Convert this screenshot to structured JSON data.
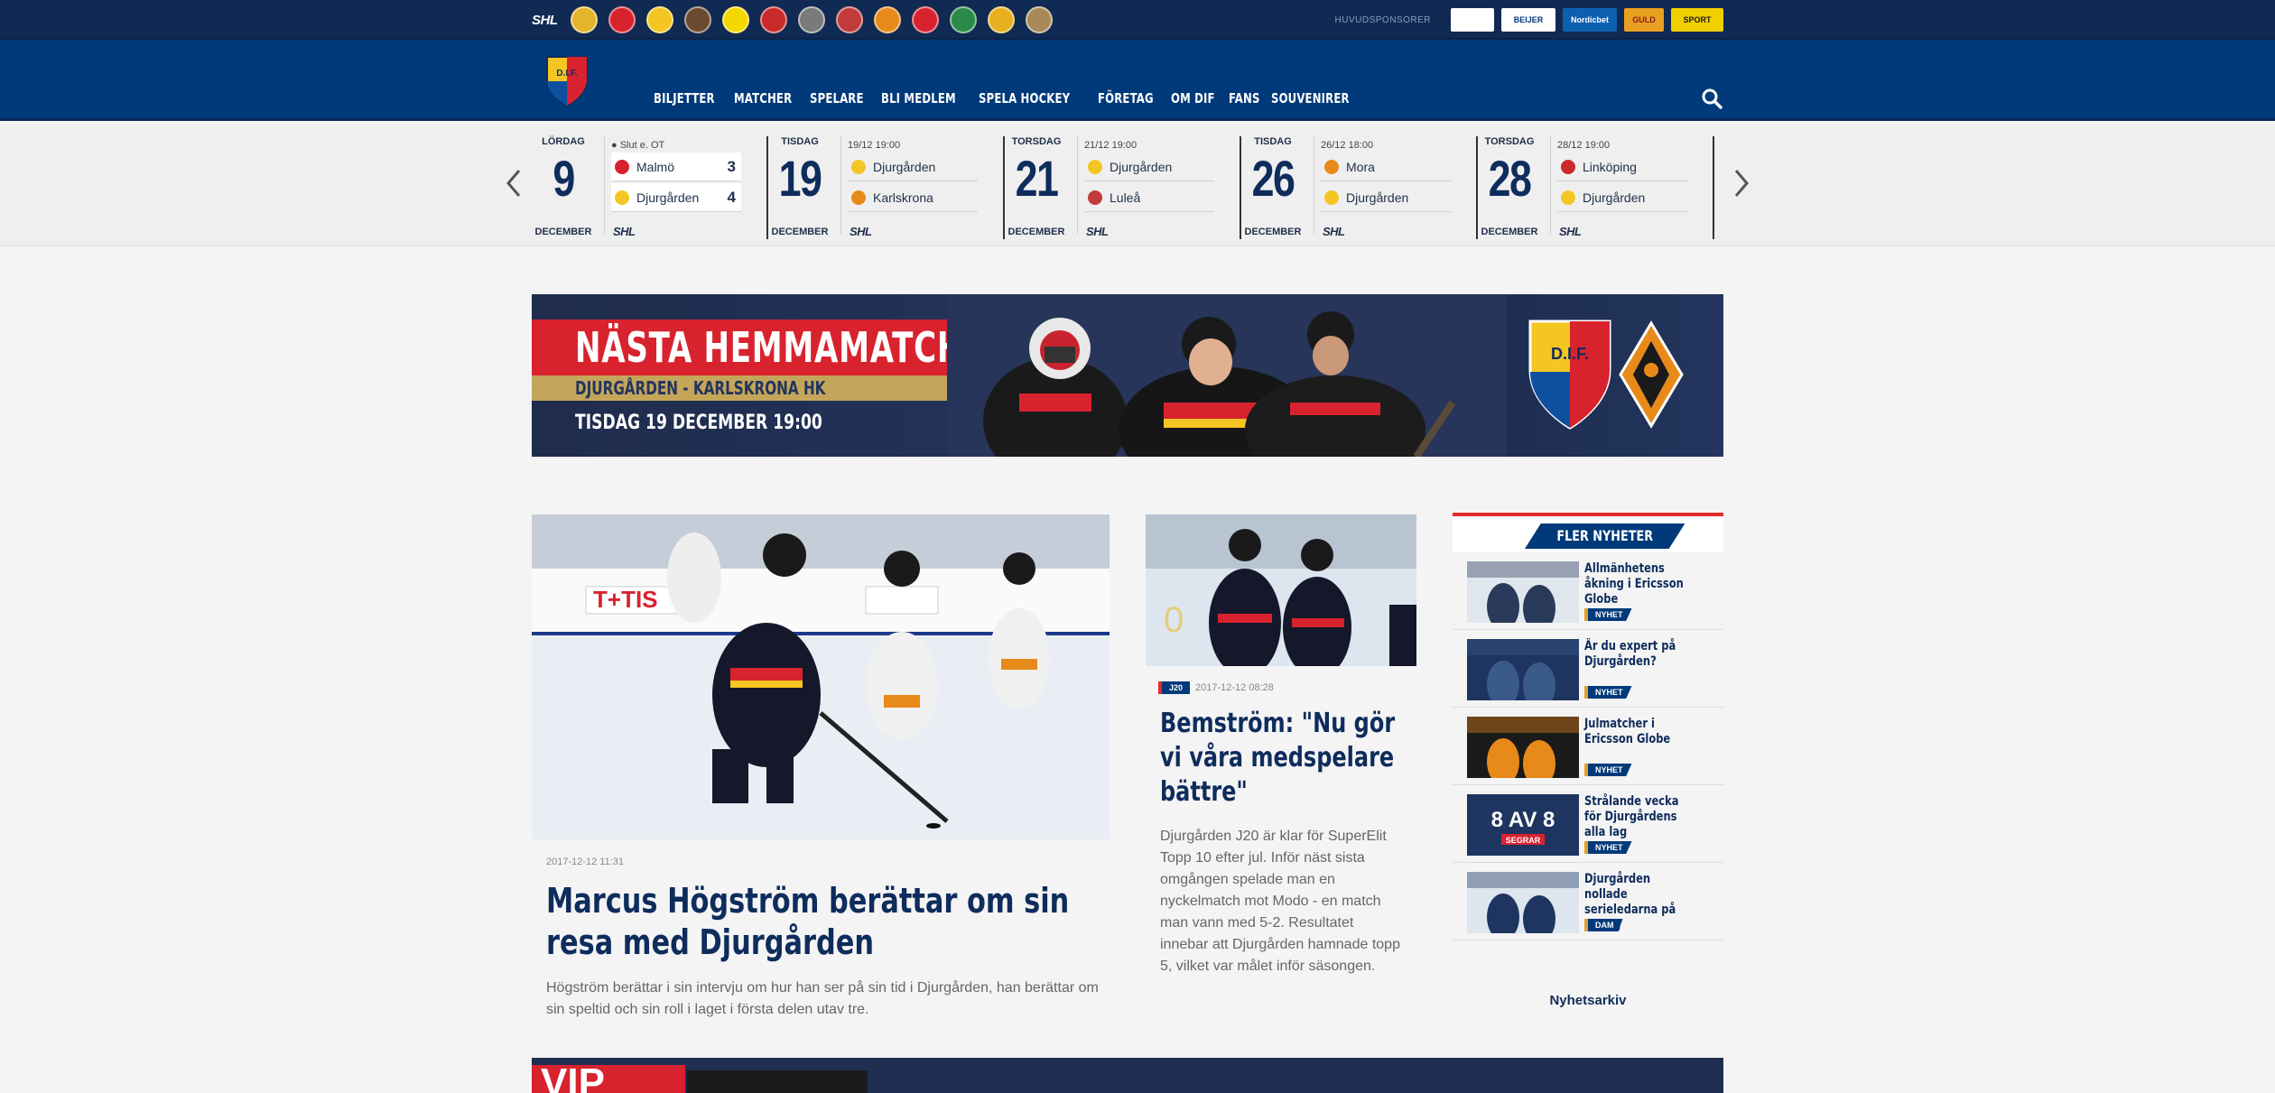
{
  "top_strip": {
    "league": "SHL",
    "sponsor_label": "HUVUDSPONSORER",
    "team_colors": [
      "#e3b52b",
      "#d8232f",
      "#f4c623",
      "#6b4a2f",
      "#f5d800",
      "#c92a2a",
      "#7a7a7a",
      "#c23a3a",
      "#e88a1a",
      "#d8232f",
      "#2a8a4a",
      "#e8b020",
      "#a88a5a"
    ],
    "sponsors": [
      {
        "label": "",
        "bg": "#ffffff",
        "color": "#003a7a",
        "width": 48
      },
      {
        "label": "BEIJER",
        "bg": "#ffffff",
        "color": "#003a7a",
        "width": 60
      },
      {
        "label": "Nordicbet",
        "bg": "#0d5fb0",
        "color": "#ffffff",
        "width": 60
      },
      {
        "label": "GULD",
        "bg": "#e8a020",
        "color": "#8a1a1a",
        "width": 44
      },
      {
        "label": "SPORT",
        "bg": "#f0d000",
        "color": "#1a1a1a",
        "width": 58
      }
    ]
  },
  "header": {
    "crest_text": "D.I.F.",
    "nav": [
      "BILJETTER",
      "MATCHER",
      "SPELARE",
      "BLI MEDLEM",
      "SPELA HOCKEY",
      "FÖRETAG",
      "OM DIF",
      "FANS",
      "SOUVENIRER"
    ]
  },
  "fixtures": [
    {
      "day": "LÖRDAG",
      "date": "9",
      "month": "DECEMBER",
      "info": "● Slut e. OT",
      "home": "Malmö",
      "away": "Djurgården",
      "home_score": "3",
      "away_score": "4",
      "home_color": "#d8232f",
      "away_color": "#f4c623",
      "league": "SHL",
      "boxed": true
    },
    {
      "day": "TISDAG",
      "date": "19",
      "month": "DECEMBER",
      "info": "19/12 19:00",
      "home": "Djurgården",
      "away": "Karlskrona",
      "home_score": "",
      "away_score": "",
      "home_color": "#f4c623",
      "away_color": "#e88a1a",
      "league": "SHL",
      "boxed": false
    },
    {
      "day": "TORSDAG",
      "date": "21",
      "month": "DECEMBER",
      "info": "21/12 19:00",
      "home": "Djurgården",
      "away": "Luleå",
      "home_score": "",
      "away_score": "",
      "home_color": "#f4c623",
      "away_color": "#c23a3a",
      "league": "SHL",
      "boxed": false
    },
    {
      "day": "TISDAG",
      "date": "26",
      "month": "DECEMBER",
      "info": "26/12 18:00",
      "home": "Mora",
      "away": "Djurgården",
      "home_score": "",
      "away_score": "",
      "home_color": "#e88a1a",
      "away_color": "#f4c623",
      "league": "SHL",
      "boxed": false
    },
    {
      "day": "TORSDAG",
      "date": "28",
      "month": "DECEMBER",
      "info": "28/12 19:00",
      "home": "Linköping",
      "away": "Djurgården",
      "home_score": "",
      "away_score": "",
      "home_color": "#c92a2a",
      "away_color": "#f4c623",
      "league": "SHL",
      "boxed": false
    }
  ],
  "banner": {
    "title": "NÄSTA HEMMAMATCH",
    "matchup": "DJURGÅRDEN - KARLSKRONA HK",
    "datetime": "TISDAG 19 DECEMBER  19:00",
    "crest_text": "D.I.F."
  },
  "main_article": {
    "date": "2017-12-12 11:31",
    "title": "Marcus Högström berättar om sin resa med Djurgården",
    "body": "Högström berättar i sin intervju om hur han ser på sin tid i Djurgården, han berättar om sin speltid och sin roll i laget i första delen utav tre."
  },
  "second_article": {
    "tag": "J20",
    "date": "2017-12-12 08:28",
    "title": "Bemström: \"Nu gör vi våra medspelare bättre\"",
    "body": "Djurgården J20 är klar för SuperElit Topp 10 efter jul. Inför näst sista omgången spelade man en nyckelmatch mot Modo - en match man vann med 5-2. Resultatet innebar att Djurgården hamnade topp 5, vilket var målet inför säsongen."
  },
  "sidebar": {
    "heading": "FLER NYHETER",
    "items": [
      {
        "title": "Allmänhetens åkning i Ericsson Globe",
        "tag": "NYHET",
        "thumb_text": ""
      },
      {
        "title": "Är du expert på Djurgården?",
        "tag": "NYHET",
        "thumb_text": ""
      },
      {
        "title": "Julmatcher i Ericsson Globe",
        "tag": "NYHET",
        "thumb_text": ""
      },
      {
        "title": "Strålande vecka för Djurgårdens alla lag",
        "tag": "NYHET",
        "thumb_text": "8 AV 8",
        "thumb_sub": "SEGRAR"
      },
      {
        "title": "Djurgården nollade serieledarna på poäng",
        "tag": "DAM",
        "thumb_text": ""
      }
    ],
    "archive_link": "Nyhetsarkiv"
  },
  "bottom_banner": {
    "label": "VIP"
  }
}
